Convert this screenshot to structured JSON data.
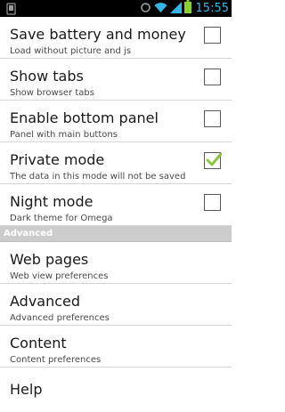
{
  "status_bar": {
    "time": "15:55",
    "icons": [
      "notification-icon",
      "sync-icon",
      "wifi-icon",
      "signal-icon",
      "battery-icon"
    ],
    "accent_color": "#35b5e5",
    "battery_color": "#8ad22a"
  },
  "settings": {
    "general": [
      {
        "title": "Save battery and money",
        "summary": "Load without picture and js",
        "checked": false
      },
      {
        "title": "Show tabs",
        "summary": "Show browser tabs",
        "checked": false
      },
      {
        "title": "Enable bottom panel",
        "summary": "Panel with main buttons",
        "checked": false
      },
      {
        "title": "Private mode",
        "summary": "The data in this mode will not be saved",
        "checked": true
      },
      {
        "title": "Night mode",
        "summary": "Dark theme for Omega",
        "checked": false
      }
    ],
    "advanced_header": "Advanced",
    "advanced": [
      {
        "title": "Web pages",
        "summary": "Web view preferences"
      },
      {
        "title": "Advanced",
        "summary": "Advanced preferences"
      },
      {
        "title": "Content",
        "summary": "Content preferences"
      }
    ],
    "help": {
      "title": "Help"
    },
    "check_color": "#8cc63f"
  }
}
